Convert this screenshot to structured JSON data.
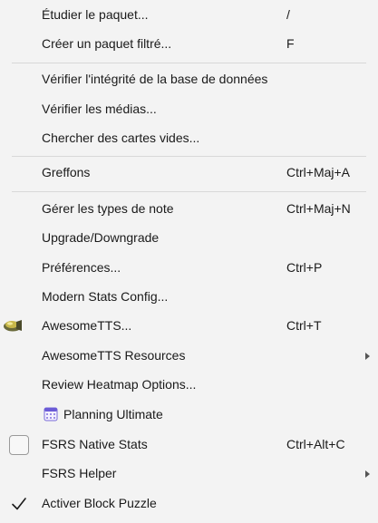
{
  "menu": {
    "study_deck": {
      "label": "Étudier le paquet...",
      "shortcut": "/"
    },
    "filtered_deck": {
      "label": "Créer un paquet filtré...",
      "shortcut": "F"
    },
    "check_database": {
      "label": "Vérifier l'intégrité de la base de données"
    },
    "check_media": {
      "label": "Vérifier les médias..."
    },
    "empty_cards": {
      "label": "Chercher des cartes vides..."
    },
    "addons": {
      "label": "Greffons",
      "shortcut": "Ctrl+Maj+A"
    },
    "note_types": {
      "label": "Gérer les types de note",
      "shortcut": "Ctrl+Maj+N"
    },
    "upgrade": {
      "label": "Upgrade/Downgrade"
    },
    "preferences": {
      "label": "Préférences...",
      "shortcut": "Ctrl+P"
    },
    "modern_stats": {
      "label": "Modern Stats Config..."
    },
    "awesometts": {
      "label": "AwesomeTTS...",
      "shortcut": "Ctrl+T",
      "icon": "speaker-icon"
    },
    "awesometts_resources": {
      "label": "AwesomeTTS Resources",
      "has_submenu": true
    },
    "heatmap": {
      "label": "Review Heatmap Options..."
    },
    "planning": {
      "label": "Planning Ultimate",
      "icon": "calendar-icon"
    },
    "fsrs_stats": {
      "label": "FSRS Native Stats",
      "shortcut": "Ctrl+Alt+C",
      "checked": false
    },
    "fsrs_helper": {
      "label": "FSRS Helper",
      "has_submenu": true
    },
    "block_puzzle": {
      "label": "Activer Block Puzzle",
      "checked": true
    }
  },
  "colors": {
    "background": "#f3f3f3",
    "separator": "#d8d8d8",
    "text": "#1a1a1a"
  }
}
